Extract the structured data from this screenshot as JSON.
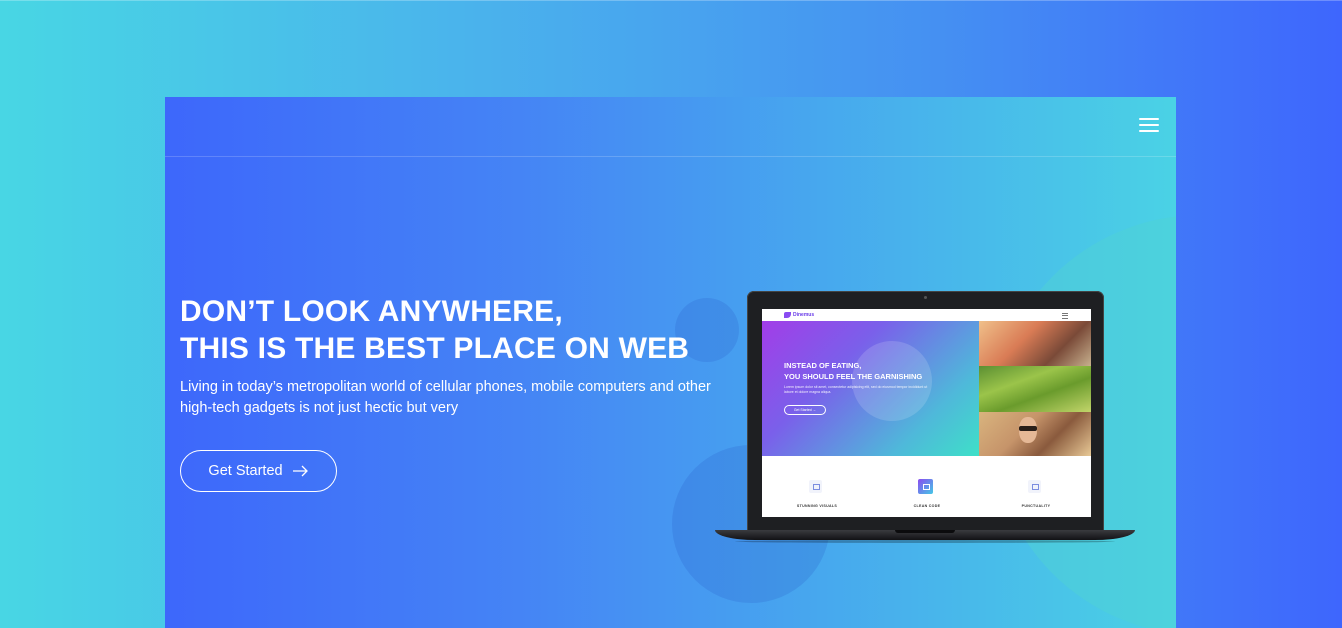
{
  "hero": {
    "headline_line1": "DON’T LOOK ANYWHERE,",
    "headline_line2": "THIS IS THE BEST PLACE ON WEB",
    "subtext": "Living in today’s metropolitan world of cellular phones, mobile computers and other high-tech gadgets is not just hectic but very",
    "cta_label": "Get Started",
    "cta_icon": "arrow-right-icon"
  },
  "navbar": {
    "menu_icon": "hamburger-menu-icon"
  },
  "laptop_screen": {
    "logo_text": "Dinemus",
    "title_line1": "INSTEAD OF EATING,",
    "title_line2": "YOU SHOULD FEEL THE GARNISHING",
    "lorem": "Lorem ipsum dolor sit amet, consectetur adipisicing elit, sed do eiusmod tempor incididunt ut labore et dolore magna aliqua.",
    "button_label": "Get Started →",
    "features": [
      "STUNNING VISUALS",
      "CLEAN CODE",
      "PUNCTUALITY"
    ]
  },
  "colors": {
    "page_gradient_start": "#48d6e4",
    "page_gradient_end": "#3e66fd",
    "hero_gradient_start": "#3d67fb",
    "hero_gradient_end": "#4ad2e5",
    "text": "#ffffff"
  }
}
